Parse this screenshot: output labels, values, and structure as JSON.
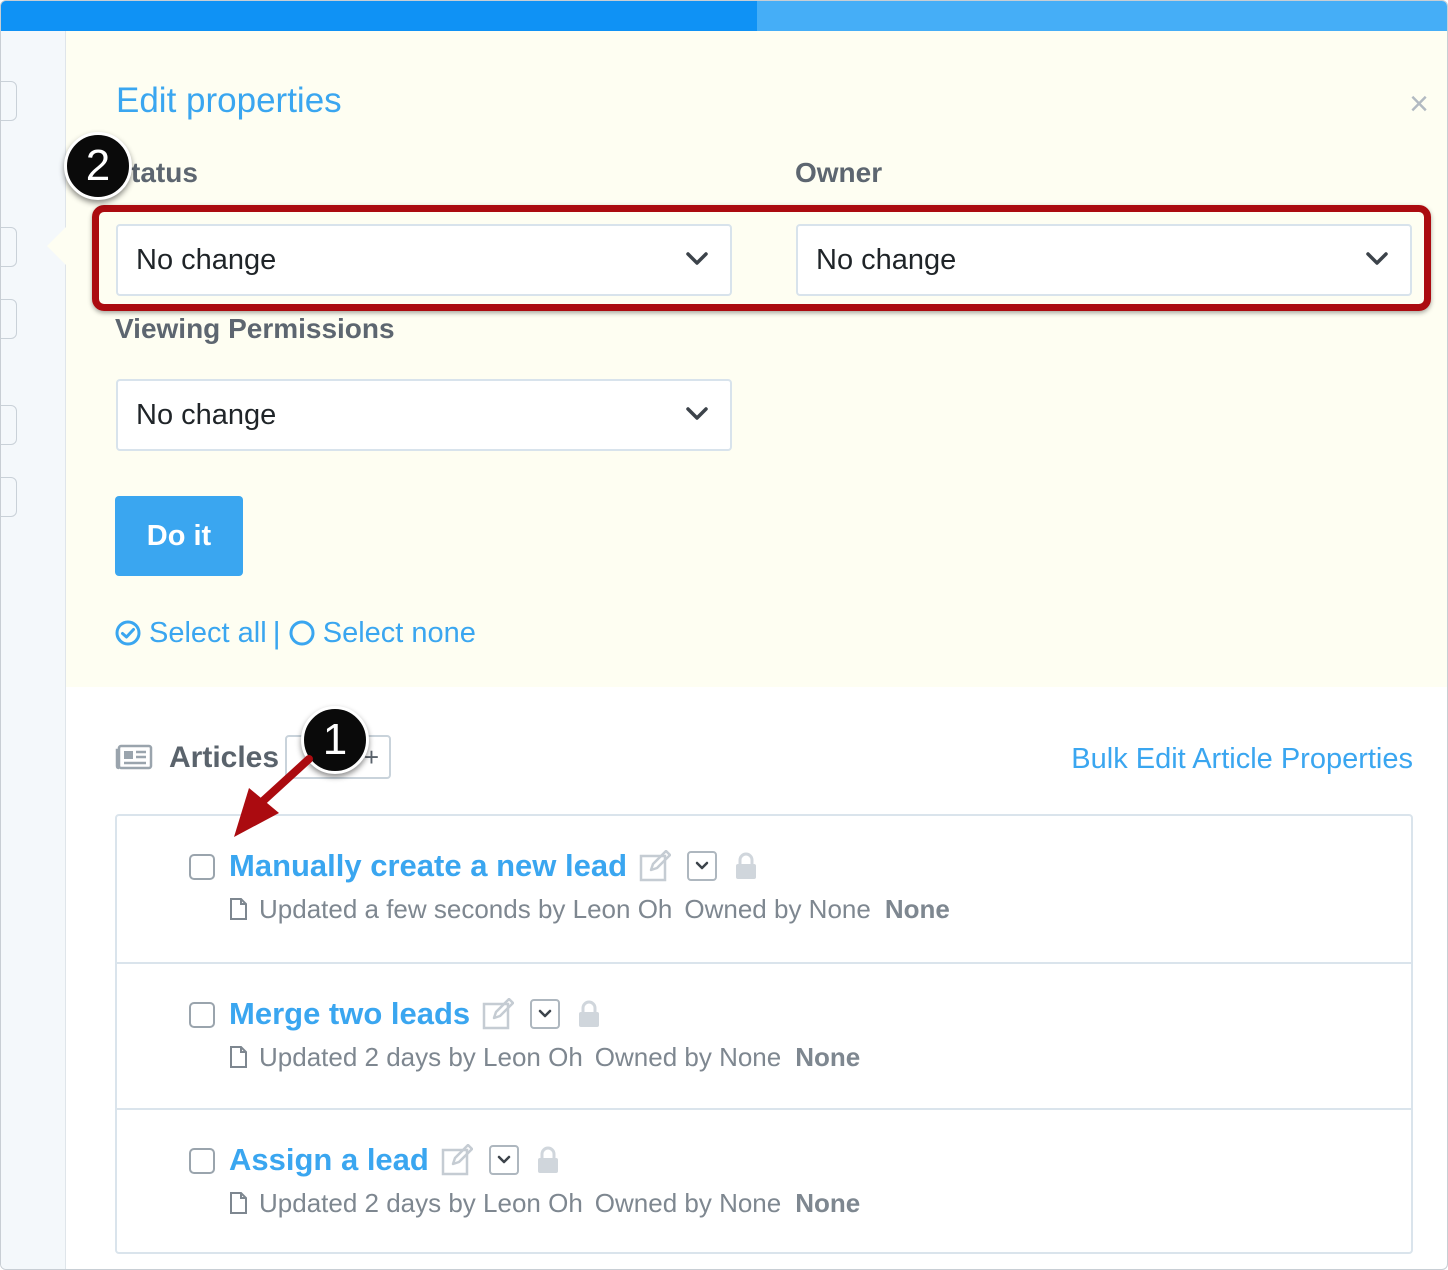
{
  "progress": {
    "fraction": 0.523
  },
  "colors": {
    "accent": "#3aa6f0",
    "annotation": "#ab0b10",
    "panel_bg": "#fefef2"
  },
  "panel": {
    "title": "Edit properties",
    "close_symbol": "×",
    "status": {
      "label": "tatus",
      "value": "No change"
    },
    "owner": {
      "label": "Owner",
      "value": "No change"
    },
    "viewing_permissions": {
      "label": "Viewing Permissions",
      "value": "No change"
    },
    "do_it_label": "Do it",
    "select_all_label": "Select all",
    "divider": "|",
    "select_none_label": "Select none"
  },
  "annotations": {
    "step_1": "1",
    "step_2": "2"
  },
  "articles": {
    "title": "Articles",
    "add_symbol": "+",
    "bulk_edit_label": "Bulk Edit Article Properties",
    "items": [
      {
        "title": "Manually create a new lead",
        "updated": "Updated a few seconds by Leon Oh",
        "owned": "Owned by None",
        "tag": "None"
      },
      {
        "title": "Merge two leads",
        "updated": "Updated 2 days by Leon Oh",
        "owned": "Owned by None",
        "tag": "None"
      },
      {
        "title": "Assign a lead",
        "updated": "Updated 2 days by Leon Oh",
        "owned": "Owned by None",
        "tag": "None"
      }
    ]
  },
  "icons": [
    "chevron-down-icon",
    "close-icon",
    "check-circle-icon",
    "circle-outline-icon",
    "newspaper-icon",
    "edit-icon",
    "lock-icon",
    "document-icon"
  ]
}
